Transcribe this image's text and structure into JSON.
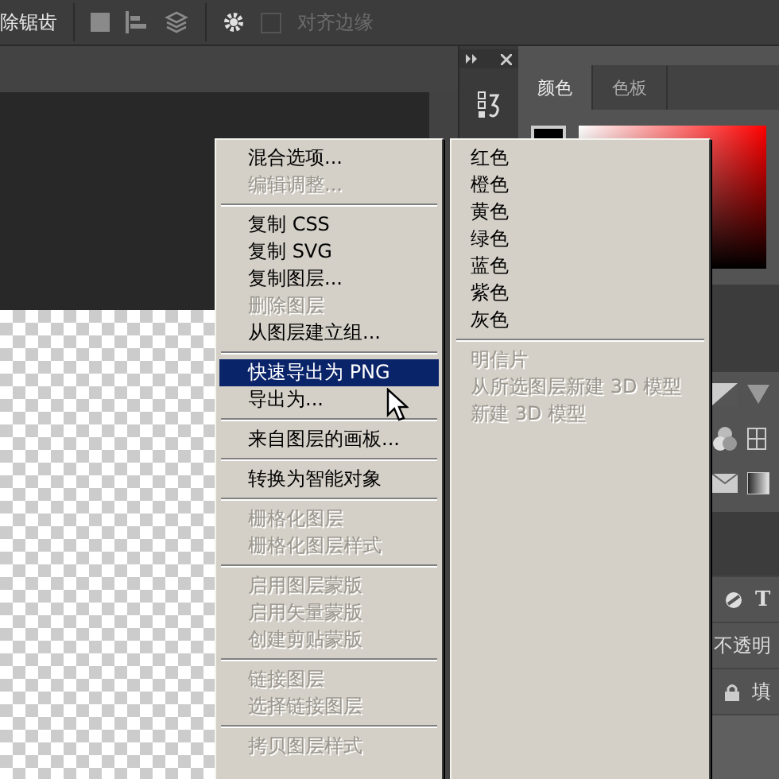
{
  "toolbar": {
    "antialias_label": "除锯齿",
    "snap_checkbox": {
      "label": "对齐边缘",
      "checked": false
    }
  },
  "color_panel": {
    "tabs": [
      {
        "label": "颜色",
        "selected": true
      },
      {
        "label": "色板",
        "selected": false
      }
    ]
  },
  "layers_panel": {
    "kind_filter_glyph": "T",
    "opacity_label": "不透明",
    "fill_label": "填"
  },
  "context_menu": {
    "items": [
      {
        "kind": "item",
        "label": "混合选项...",
        "disabled": false,
        "selected": false
      },
      {
        "kind": "item",
        "label": "编辑调整...",
        "disabled": true,
        "selected": false
      },
      {
        "kind": "separator"
      },
      {
        "kind": "item",
        "label": "复制 CSS",
        "disabled": false,
        "selected": false
      },
      {
        "kind": "item",
        "label": "复制 SVG",
        "disabled": false,
        "selected": false
      },
      {
        "kind": "item",
        "label": "复制图层...",
        "disabled": false,
        "selected": false
      },
      {
        "kind": "item",
        "label": "删除图层",
        "disabled": true,
        "selected": false
      },
      {
        "kind": "item",
        "label": "从图层建立组...",
        "disabled": false,
        "selected": false
      },
      {
        "kind": "separator"
      },
      {
        "kind": "item",
        "label": "快速导出为 PNG",
        "disabled": false,
        "selected": true
      },
      {
        "kind": "item",
        "label": "导出为...",
        "disabled": false,
        "selected": false
      },
      {
        "kind": "separator"
      },
      {
        "kind": "item",
        "label": "来自图层的画板...",
        "disabled": false,
        "selected": false
      },
      {
        "kind": "separator"
      },
      {
        "kind": "item",
        "label": "转换为智能对象",
        "disabled": false,
        "selected": false
      },
      {
        "kind": "separator"
      },
      {
        "kind": "item",
        "label": "栅格化图层",
        "disabled": true,
        "selected": false
      },
      {
        "kind": "item",
        "label": "栅格化图层样式",
        "disabled": true,
        "selected": false
      },
      {
        "kind": "separator"
      },
      {
        "kind": "item",
        "label": "启用图层蒙版",
        "disabled": true,
        "selected": false
      },
      {
        "kind": "item",
        "label": "启用矢量蒙版",
        "disabled": true,
        "selected": false
      },
      {
        "kind": "item",
        "label": "创建剪贴蒙版",
        "disabled": true,
        "selected": false
      },
      {
        "kind": "separator"
      },
      {
        "kind": "item",
        "label": "链接图层",
        "disabled": true,
        "selected": false
      },
      {
        "kind": "item",
        "label": "选择链接图层",
        "disabled": true,
        "selected": false
      },
      {
        "kind": "separator"
      },
      {
        "kind": "item",
        "label": "拷贝图层样式",
        "disabled": true,
        "selected": false
      }
    ]
  },
  "submenu": {
    "items": [
      {
        "kind": "item",
        "label": "红色",
        "disabled": false,
        "selected": false
      },
      {
        "kind": "item",
        "label": "橙色",
        "disabled": false,
        "selected": false
      },
      {
        "kind": "item",
        "label": "黄色",
        "disabled": false,
        "selected": false
      },
      {
        "kind": "item",
        "label": "绿色",
        "disabled": false,
        "selected": false
      },
      {
        "kind": "item",
        "label": "蓝色",
        "disabled": false,
        "selected": false
      },
      {
        "kind": "item",
        "label": "紫色",
        "disabled": false,
        "selected": false
      },
      {
        "kind": "item",
        "label": "灰色",
        "disabled": false,
        "selected": false
      },
      {
        "kind": "separator"
      },
      {
        "kind": "item",
        "label": "明信片",
        "disabled": true,
        "selected": false
      },
      {
        "kind": "item",
        "label": "从所选图层新建 3D 模型",
        "disabled": true,
        "selected": false
      },
      {
        "kind": "item",
        "label": "新建 3D 模型",
        "disabled": true,
        "selected": false
      }
    ]
  }
}
